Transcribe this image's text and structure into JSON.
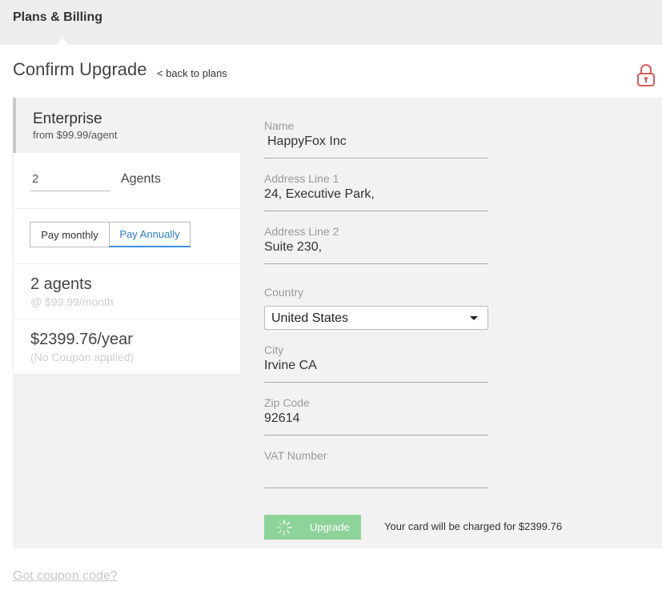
{
  "header": {
    "title": "Plans & Billing"
  },
  "page": {
    "title": "Confirm Upgrade",
    "back_link": "< back to plans"
  },
  "plan": {
    "name": "Enterprise",
    "price": "from $99.99/agent"
  },
  "agents": {
    "value": "2",
    "label": "Agents"
  },
  "billing_toggle": {
    "options": [
      "Pay monthly",
      "Pay Annually"
    ],
    "selected": "Pay Annually"
  },
  "summary": {
    "agents_count": "2 agents",
    "rate": "@ $99.99/month",
    "total": "$2399.76/year",
    "coupon_status": "(No Coupon applied)"
  },
  "form": {
    "name": {
      "label": "Name",
      "value": "HappyFox Inc"
    },
    "address1": {
      "label": "Address Line 1",
      "value": "24, Executive Park,"
    },
    "address2": {
      "label": "Address Line 2",
      "value": "Suite 230,"
    },
    "country": {
      "label": "Country",
      "value": "United States"
    },
    "city": {
      "label": "City",
      "value": "Irvine CA"
    },
    "zip": {
      "label": "Zip Code",
      "value": "92614"
    },
    "vat": {
      "label": "VAT Number",
      "value": ""
    }
  },
  "actions": {
    "upgrade_label": "Upgrade",
    "charge_note": "Your card will be charged for $2399.76"
  },
  "coupon_link": "Got coupon code?",
  "colors": {
    "accent_blue": "#2e7fd0",
    "upgrade_green": "#8ed39a",
    "lock_red": "#e05a5a",
    "panel_gray": "#f2f2f2"
  },
  "icons": {
    "lock": "lock-icon",
    "spinner": "spinner-icon",
    "dropdown": "chevron-down-icon"
  }
}
